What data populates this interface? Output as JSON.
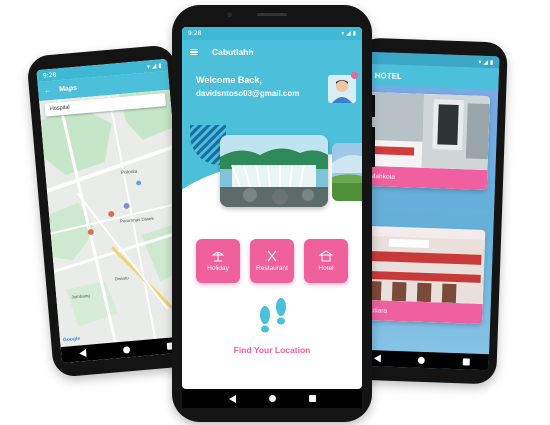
{
  "colors": {
    "primary": "#4cc0da",
    "accent": "#f0609a",
    "statusbar": "#3fb9d3"
  },
  "left_phone": {
    "status_time": "9:28",
    "app_title": "Maps",
    "search_value": "Hospital",
    "map_labels": [
      "Polonia",
      "Perumnas Diwek",
      "Jombang",
      "Dwiatu"
    ],
    "nav": [
      "back-icon",
      "home-icon",
      "recent-apps-icon"
    ]
  },
  "center_phone": {
    "status_time": "9:28",
    "app_title": "Cabutlahh",
    "welcome_text": "Welcome Back,",
    "email": "davidsntoso03@gmail.com",
    "categories": [
      {
        "label": "Holiday",
        "icon": "holiday-icon"
      },
      {
        "label": "Restaurant",
        "icon": "restaurant-icon"
      },
      {
        "label": "Hotel",
        "icon": "hotel-icon"
      }
    ],
    "find_location_label": "Find Your Location",
    "nav": [
      "back-icon",
      "home-icon",
      "recent-apps-icon"
    ]
  },
  "right_phone": {
    "app_title": "HOTEL",
    "hotels": [
      {
        "name": "el Mahkota"
      },
      {
        "name": "el Mutiara"
      }
    ],
    "nav": [
      "back-icon",
      "home-icon",
      "recent-apps-icon"
    ]
  }
}
